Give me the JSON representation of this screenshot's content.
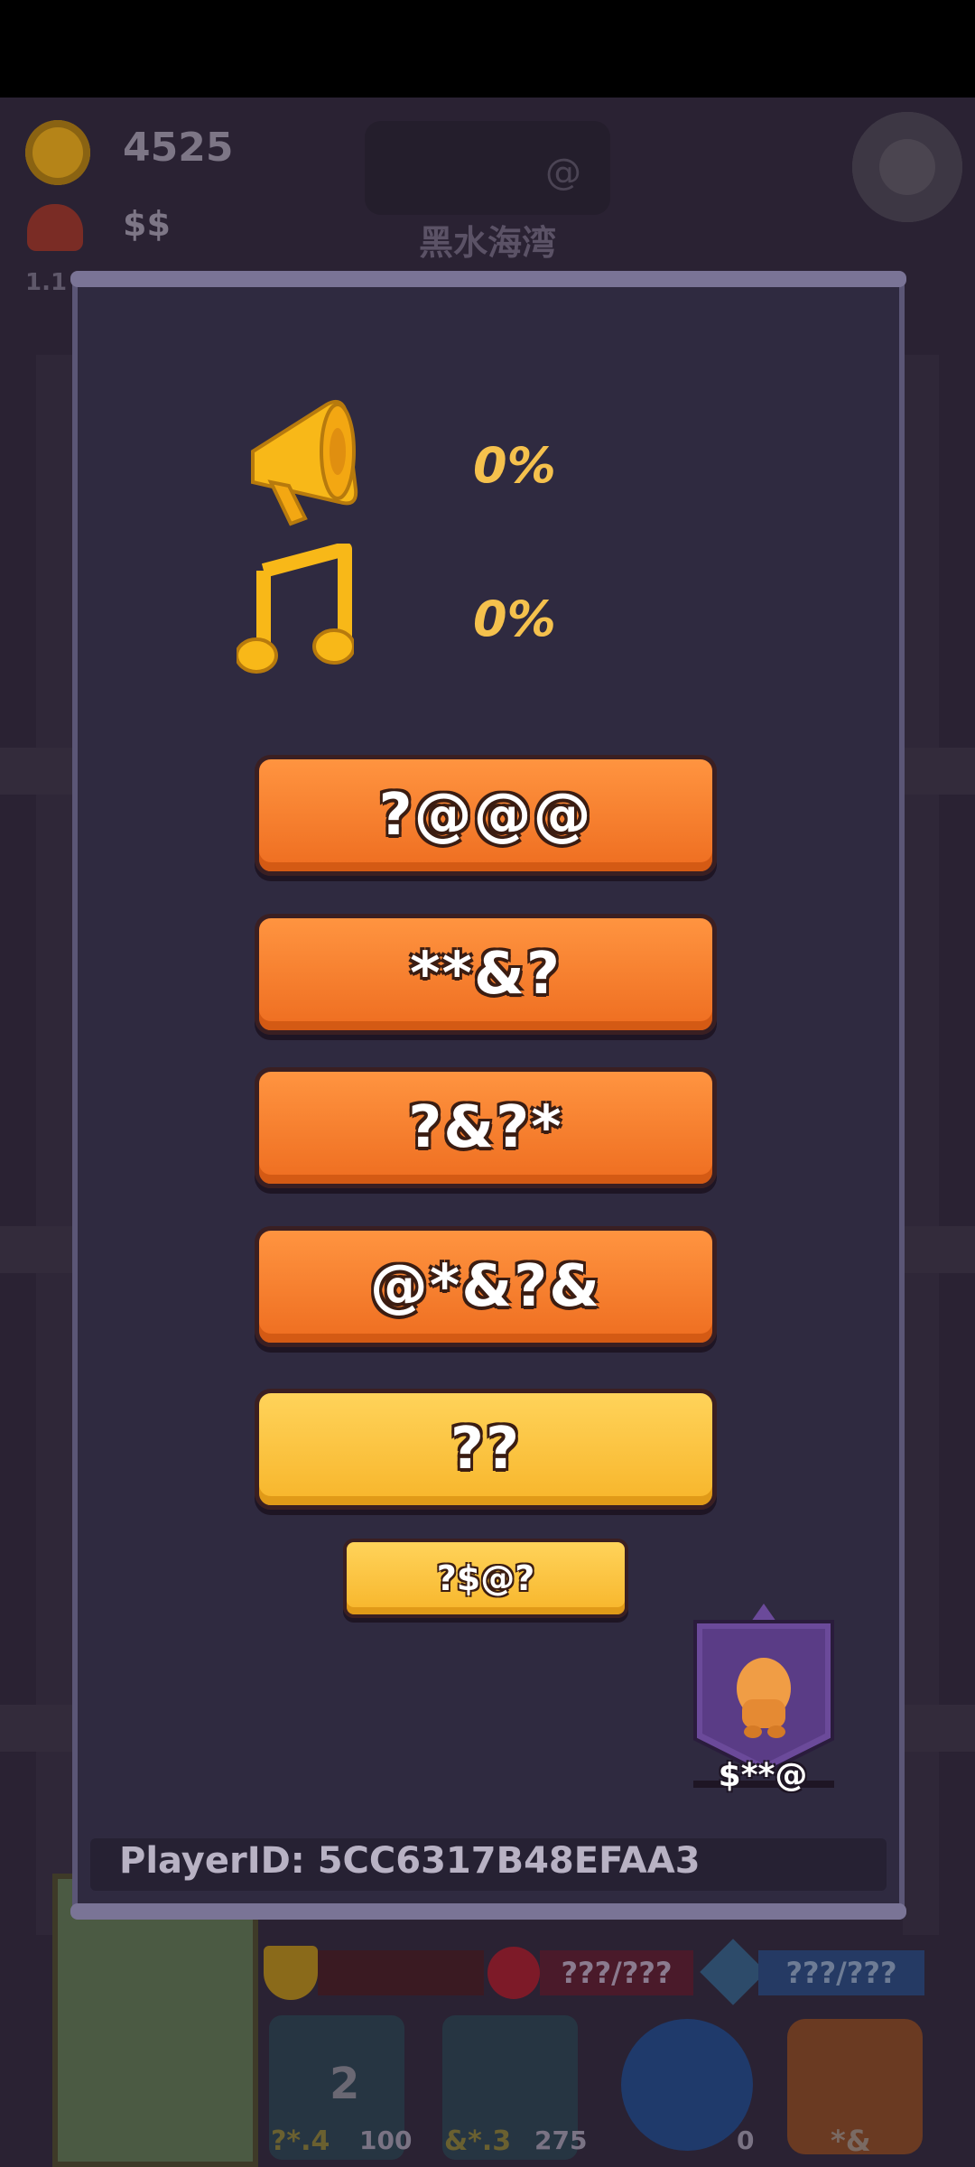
{
  "hud": {
    "coins": "4525",
    "money": "$$",
    "level_hint": "1.1",
    "location_at": "@",
    "location_name": "黑水海湾"
  },
  "settings": {
    "sound_volume": "0%",
    "music_volume": "0%",
    "buttons": [
      "?@@@",
      "**&?",
      "?&?*",
      "@*&?&",
      "??"
    ],
    "small_button": "?$@?",
    "character_label": "$**@",
    "player_id": "PlayerID: 5CC6317B48EFAA3"
  },
  "bottom_bar": {
    "hp": "???/???",
    "mp": "???/???",
    "slot1_count": "2",
    "slot1_label": "?*.4",
    "slot1_value": "100",
    "slot2_label": "&*.3",
    "slot2_value": "275",
    "slot3_value": "0",
    "bag_label": "*&"
  },
  "colors": {
    "accent_orange": "#f07a2a",
    "accent_yellow": "#f9c23c",
    "volume_text": "#f5c14d",
    "panel": "#2f2a40"
  }
}
